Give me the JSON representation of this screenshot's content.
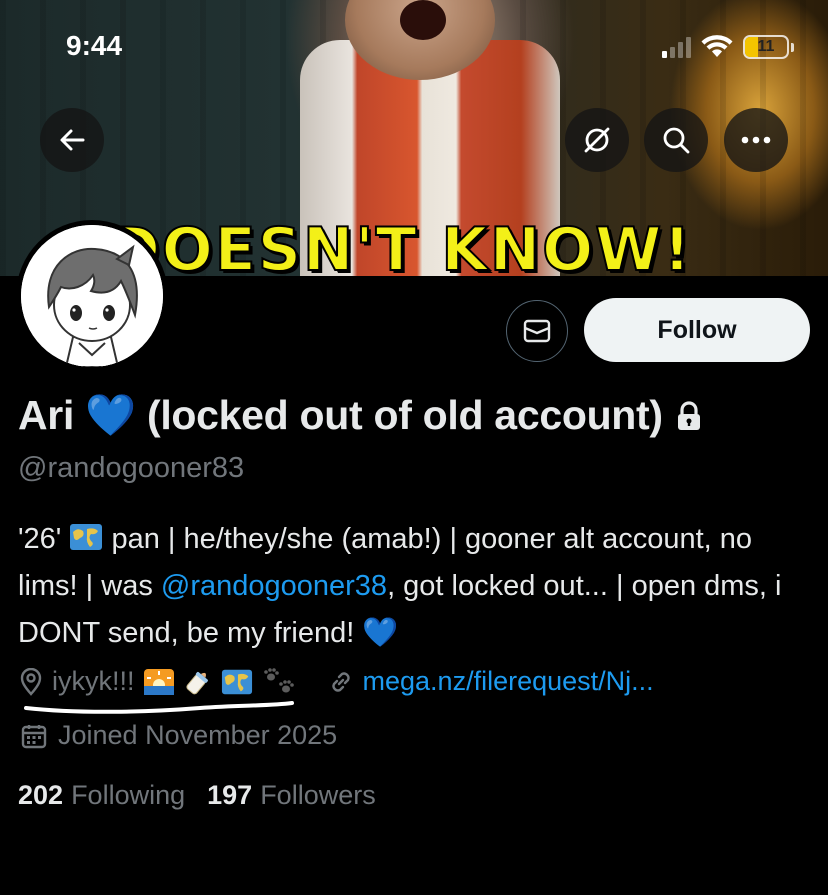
{
  "status_bar": {
    "time": "9:44",
    "battery": "11"
  },
  "banner": {
    "caption": "DOESN'T KNOW!"
  },
  "profile": {
    "display_name": "Ari 💙 (locked out of old account)",
    "handle": "@randogooner83",
    "bio": {
      "part1": "'26' ",
      "part2": " pan | he/they/she (amab!) | gooner alt account, no lims! | was ",
      "mention": "@randogooner38",
      "part3": ", got locked out... | open dms, i DONT send, be my friend! 💙"
    },
    "location": "iykyk!!!",
    "website": "mega.nz/filerequest/Nj...",
    "joined": "Joined November 2025",
    "following_count": "202",
    "following_label": "Following",
    "followers_count": "197",
    "followers_label": "Followers"
  },
  "actions": {
    "follow_label": "Follow"
  },
  "icons": {
    "back": "arrow-left-icon",
    "grok": "grok-icon",
    "search": "search-icon",
    "more": "more-icon",
    "message": "envelope-icon",
    "lock": "lock-icon",
    "location": "location-pin-icon",
    "link": "link-icon",
    "calendar": "calendar-icon"
  },
  "colors": {
    "accent": "#1d9bf0",
    "secondary_text": "#71767b",
    "follow_bg": "#eff3f4"
  }
}
